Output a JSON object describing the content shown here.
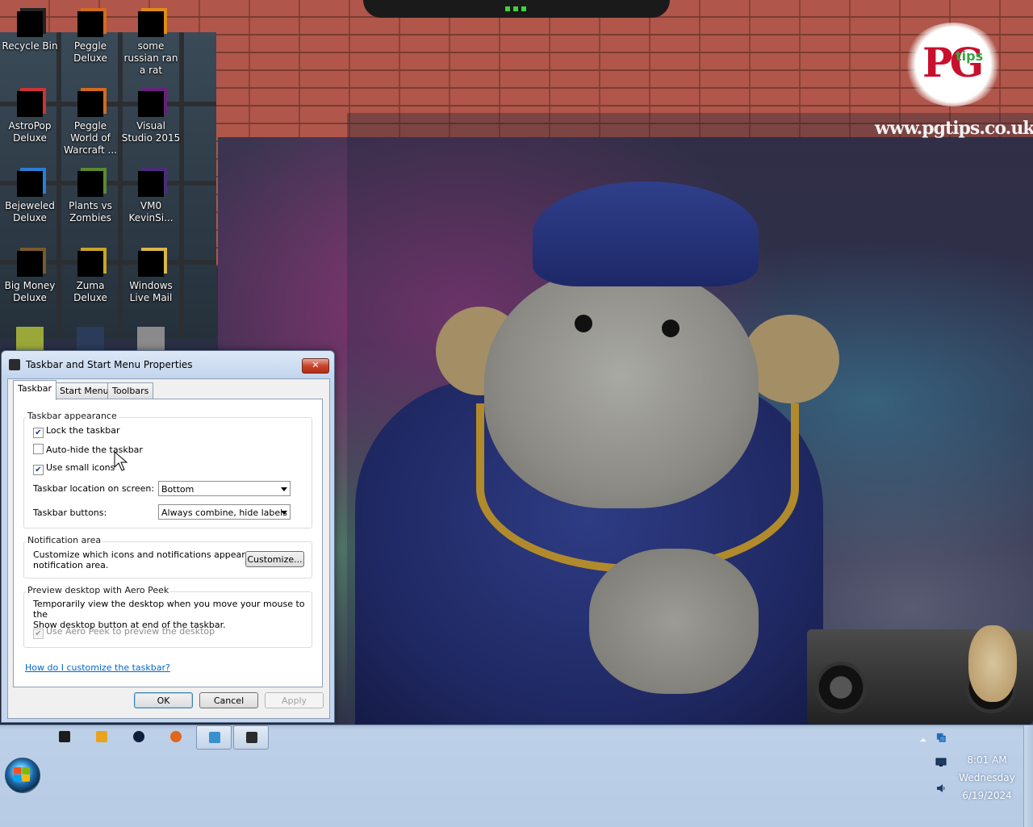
{
  "desktop": {
    "icons": [
      {
        "label": "Recycle Bin",
        "icon": "recycle-bin-icon"
      },
      {
        "label": "Peggle Deluxe",
        "icon": "peggle-deluxe-icon"
      },
      {
        "label": "some russian ran a rat",
        "icon": "shortcut-icon"
      },
      {
        "label": "AstroPop Deluxe",
        "icon": "astropop-icon"
      },
      {
        "label": "Peggle World of Warcraft ...",
        "icon": "peggle-wow-icon"
      },
      {
        "label": "Visual Studio 2015",
        "icon": "visual-studio-icon"
      },
      {
        "label": "Bejeweled Deluxe",
        "icon": "bejeweled-icon"
      },
      {
        "label": "Plants vs Zombies",
        "icon": "plants-vs-zombies-icon"
      },
      {
        "label": "VM0 KevinSi...",
        "icon": "vm-icon"
      },
      {
        "label": "Big Money Deluxe",
        "icon": "big-money-icon"
      },
      {
        "label": "Zuma Deluxe",
        "icon": "zuma-icon"
      },
      {
        "label": "Windows Live Mail",
        "icon": "live-mail-icon"
      }
    ]
  },
  "wallpaper": {
    "logo_text": "PG",
    "logo_sub": "tips",
    "url": "www.pgtips.co.uk"
  },
  "dialog": {
    "title": "Taskbar and Start Menu Properties",
    "close_label": "✕",
    "tabs": [
      "Taskbar",
      "Start Menu",
      "Toolbars"
    ],
    "active_tab": "Taskbar",
    "appearance": {
      "title": "Taskbar appearance",
      "lock_label": "Lock the taskbar",
      "lock_checked": true,
      "autohide_label": "Auto-hide the taskbar",
      "autohide_checked": false,
      "small_icons_label": "Use small icons",
      "small_icons_checked": true,
      "location_label": "Taskbar location on screen:",
      "location_value": "Bottom",
      "buttons_label": "Taskbar buttons:",
      "buttons_value": "Always combine, hide labels"
    },
    "notification": {
      "title": "Notification area",
      "text_line1": "Customize which icons and notifications appear in the",
      "text_line2": "notification area.",
      "customize_label": "Customize..."
    },
    "aero_peek": {
      "title": "Preview desktop with Aero Peek",
      "text_line1": "Temporarily view the desktop when you move your mouse to the",
      "text_line2": "Show desktop button at end of the taskbar.",
      "checkbox_label": "Use Aero Peek to preview the desktop",
      "checkbox_checked": true,
      "checkbox_enabled": false
    },
    "help_link": "How do I customize the taskbar?",
    "ok_label": "OK",
    "cancel_label": "Cancel",
    "apply_label": "Apply"
  },
  "taskbar": {
    "pinned": [
      {
        "icon": "black-app-icon",
        "active": false
      },
      {
        "icon": "media-player-icon",
        "active": false
      },
      {
        "icon": "dark-circle-app-icon",
        "active": false
      },
      {
        "icon": "firefox-icon",
        "active": false
      },
      {
        "icon": "control-panel-icon",
        "active": true
      },
      {
        "icon": "taskbar-properties-icon",
        "active": true
      }
    ],
    "clock": {
      "time": "8:01 AM",
      "day": "Wednesday",
      "date": "6/19/2024"
    },
    "tray_icons": [
      "show-hidden-icons-arrow",
      "network-icon",
      "display-icon",
      "volume-icon"
    ]
  }
}
